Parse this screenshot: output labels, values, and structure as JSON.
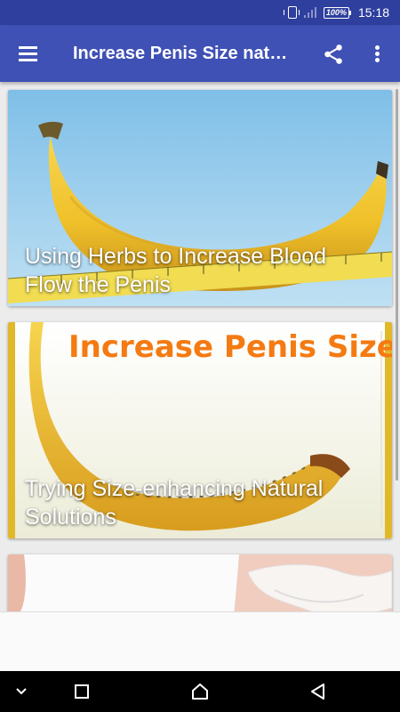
{
  "status_bar": {
    "time": "15:18",
    "battery_text": "100%",
    "icons": [
      "vibrate-icon",
      "signal-icon",
      "battery-icon"
    ]
  },
  "app_bar": {
    "title": "Increase Penis Size nat…",
    "icons": [
      "menu-icon",
      "share-icon",
      "more-vert-icon"
    ],
    "color": "#3f51b5"
  },
  "articles": [
    {
      "title": "Using Herbs to Increase Blood Flow the Penis",
      "image": "banana-with-measuring-tape-photo"
    },
    {
      "title": "Trying Size-enhancing Natural Solutions",
      "image": "banana-poster-photo",
      "image_text": "Increase Penis Size"
    },
    {
      "title": "",
      "image": "torso-photo"
    }
  ],
  "nav_bar": {
    "icons": [
      "chevron-down-icon",
      "recents-icon",
      "home-icon",
      "back-icon"
    ]
  },
  "colors": {
    "status_bar": "#2f3f9e",
    "background": "#ececec",
    "nav_bar": "#000000"
  }
}
